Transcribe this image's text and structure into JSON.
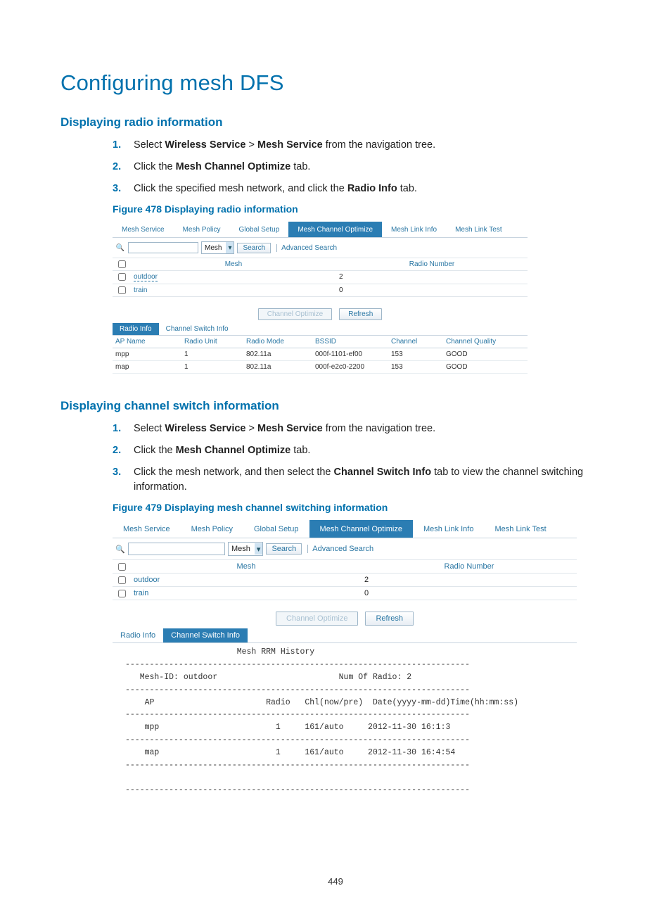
{
  "page_number": "449",
  "title": "Configuring mesh DFS",
  "section1": {
    "heading": "Displaying radio information",
    "steps": [
      {
        "pre": "Select ",
        "b1": "Wireless Service",
        "mid": " > ",
        "b2": "Mesh Service",
        "post": " from the navigation tree."
      },
      {
        "pre": "Click the ",
        "b1": "Mesh Channel Optimize",
        "post": " tab."
      },
      {
        "pre": "Click the specified mesh network, and click the ",
        "b1": "Radio Info",
        "post": " tab."
      }
    ],
    "figure_caption": "Figure 478 Displaying radio information"
  },
  "fig478": {
    "tabs": [
      "Mesh Service",
      "Mesh Policy",
      "Global Setup",
      "Mesh Channel Optimize",
      "Mesh Link Info",
      "Mesh Link Test"
    ],
    "active_tab_index": 3,
    "search": {
      "select": "Mesh",
      "button": "Search",
      "advanced": "Advanced Search"
    },
    "grid": {
      "head": [
        "Mesh",
        "Radio Number"
      ],
      "rows": [
        {
          "name": "outdoor",
          "radio": "2",
          "dashed": true
        },
        {
          "name": "train",
          "radio": "0",
          "dashed": false
        }
      ]
    },
    "center_buttons": {
      "optimize": "Channel Optimize",
      "refresh": "Refresh"
    },
    "subtabs": [
      "Radio Info",
      "Channel Switch Info"
    ],
    "active_subtab_index": 0,
    "table": {
      "head": [
        "AP Name",
        "Radio Unit",
        "Radio Mode",
        "BSSID",
        "Channel",
        "Channel Quality"
      ],
      "rows": [
        [
          "mpp",
          "1",
          "802.11a",
          "000f-1101-ef00",
          "153",
          "GOOD"
        ],
        [
          "map",
          "1",
          "802.11a",
          "000f-e2c0-2200",
          "153",
          "GOOD"
        ]
      ]
    }
  },
  "section2": {
    "heading": "Displaying channel switch information",
    "steps": [
      {
        "pre": "Select ",
        "b1": "Wireless Service",
        "mid": " > ",
        "b2": "Mesh Service",
        "post": " from the navigation tree."
      },
      {
        "pre": "Click the ",
        "b1": "Mesh Channel Optimize",
        "post": " tab."
      },
      {
        "pre": "Click the mesh network, and then select the ",
        "b1": "Channel Switch Info",
        "post": " tab to view the channel switching information."
      }
    ],
    "figure_caption": "Figure 479 Displaying mesh channel switching information"
  },
  "fig479": {
    "tabs": [
      "Mesh Service",
      "Mesh Policy",
      "Global Setup",
      "Mesh Channel Optimize",
      "Mesh Link Info",
      "Mesh Link Test"
    ],
    "active_tab_index": 3,
    "search": {
      "select": "Mesh",
      "button": "Search",
      "advanced": "Advanced Search"
    },
    "grid": {
      "head": [
        "Mesh",
        "Radio Number"
      ],
      "rows": [
        {
          "name": "outdoor",
          "radio": "2",
          "dashed": false
        },
        {
          "name": "train",
          "radio": "0",
          "dashed": false
        }
      ]
    },
    "center_buttons": {
      "optimize": "Channel Optimize",
      "refresh": "Refresh"
    },
    "subtabs": [
      "Radio Info",
      "Channel Switch Info"
    ],
    "active_subtab_index": 1,
    "mono": "                       Mesh RRM History\n-----------------------------------------------------------------------\n   Mesh-ID: outdoor                         Num Of Radio: 2\n-----------------------------------------------------------------------\n    AP                       Radio   Chl(now/pre)  Date(yyyy-mm-dd)Time(hh:mm:ss)\n-----------------------------------------------------------------------\n    mpp                        1     161/auto     2012-11-30 16:1:3\n-----------------------------------------------------------------------\n    map                        1     161/auto     2012-11-30 16:4:54\n-----------------------------------------------------------------------\n\n-----------------------------------------------------------------------"
  }
}
